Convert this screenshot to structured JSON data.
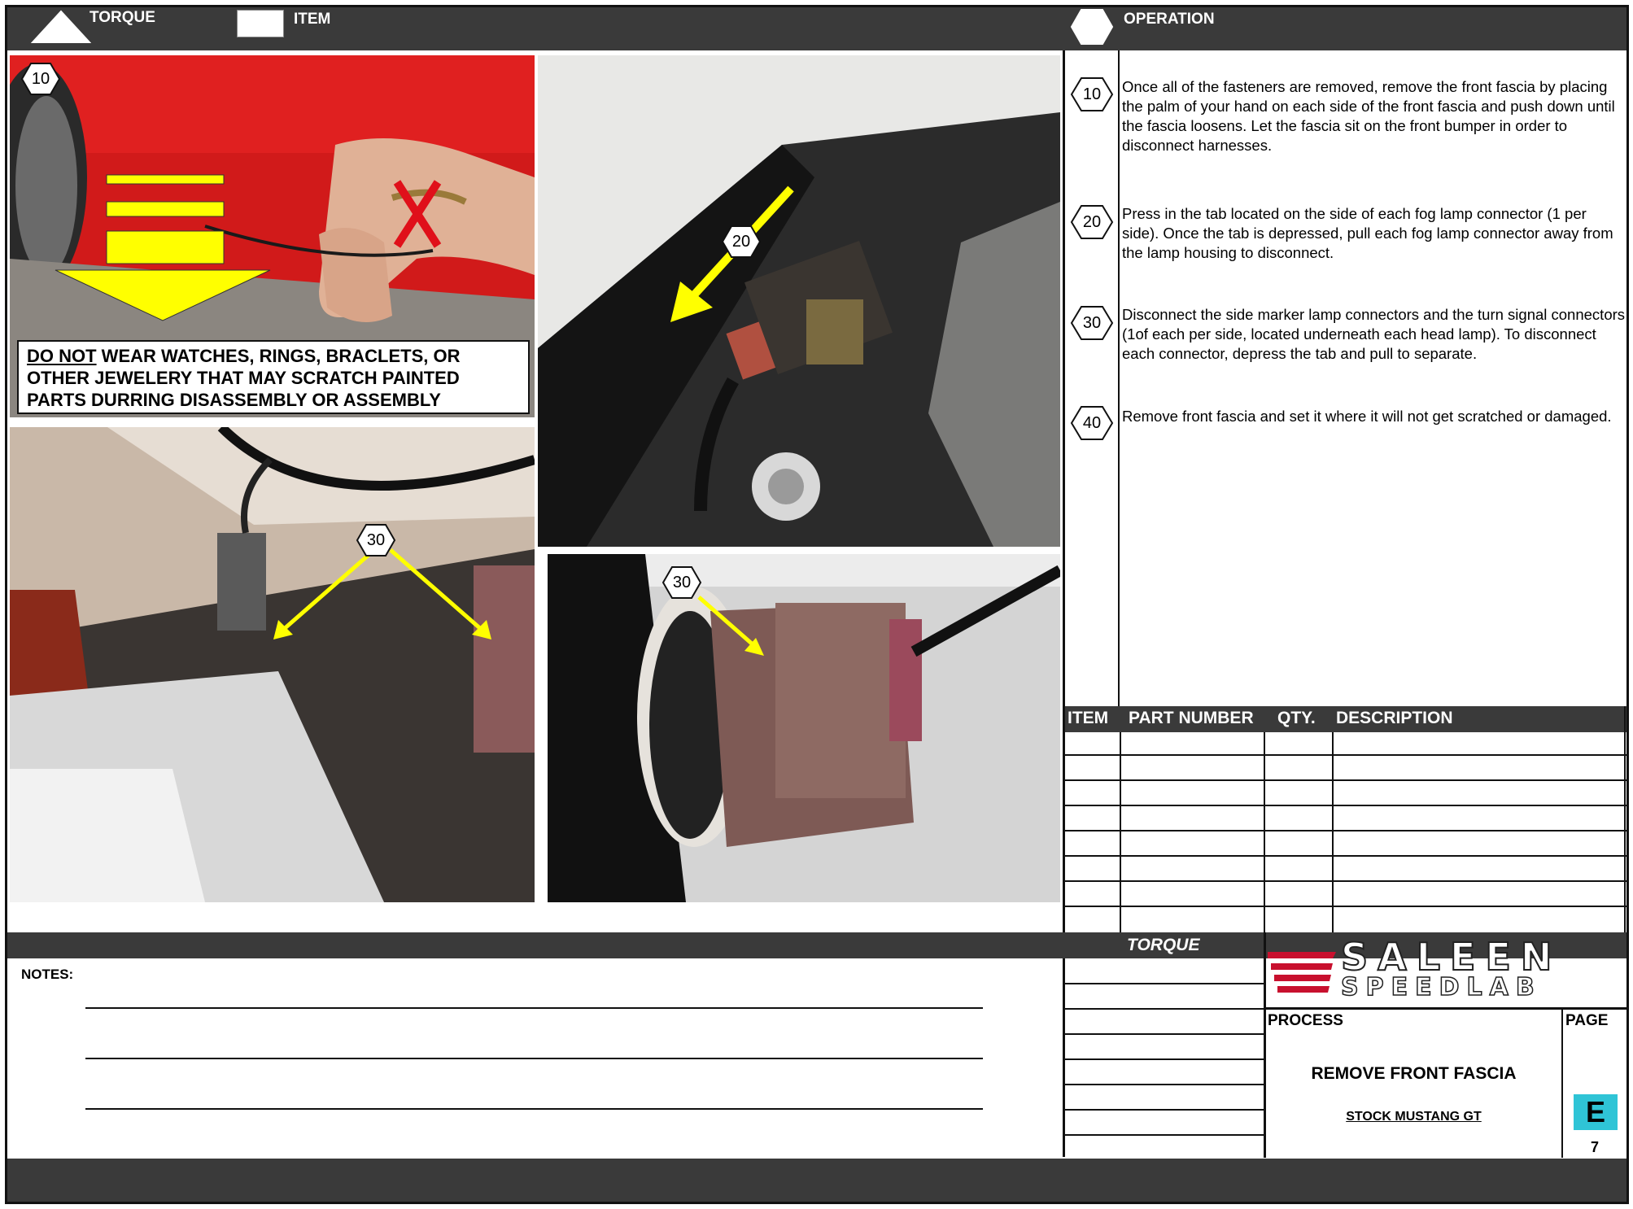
{
  "header": {
    "torque_label": "TORQUE",
    "item_label": "ITEM",
    "operation_label": "OPERATION"
  },
  "warning": {
    "emphasis": "DO NOT",
    "text": " WEAR WATCHES, RINGS, BRACLETS, OR OTHER JEWELERY THAT MAY SCRATCH PAINTED PARTS DURRING DISASSEMBLY OR ASSEMBLY"
  },
  "photo_callouts": {
    "photo1": "10",
    "photo2": "20",
    "photo3": "30",
    "photo4": "30"
  },
  "operations": [
    {
      "number": "10",
      "text": "Once all of the fasteners are removed, remove the front fascia by placing the palm of your hand on each side of the front fascia and push down until the fascia loosens.  Let the fascia sit on the front bumper in order to disconnect harnesses."
    },
    {
      "number": "20",
      "text": "Press in the tab located on the side of each fog lamp connector (1 per side).  Once the tab is depressed, pull each fog lamp connector away from the lamp housing to disconnect."
    },
    {
      "number": "30",
      "text": "Disconnect the side marker lamp connectors and the turn signal connectors (1of each per side, located underneath each head lamp).  To disconnect each connector, depress the tab and pull to separate."
    },
    {
      "number": "40",
      "text": "Remove front fascia and set it where it will not get scratched or damaged."
    }
  ],
  "parts_table": {
    "columns": [
      "ITEM",
      "PART NUMBER",
      "QTY.",
      "DESCRIPTION"
    ],
    "rows": []
  },
  "footer": {
    "torque_label": "TORQUE",
    "notes_label": "NOTES:",
    "brand_line1": "SALEEN",
    "brand_line2": "SPEEDLAB",
    "process_label": "PROCESS",
    "page_label": "PAGE",
    "process_title": "REMOVE FRONT FASCIA",
    "process_subtitle": "STOCK MUSTANG GT",
    "page_letter": "E",
    "page_number": "7"
  },
  "colors": {
    "header_bar": "#3a3a3a",
    "arrow_yellow": "#ffff00",
    "cross_red": "#e0101a",
    "page_letter_bg": "#2fc4d6",
    "brand_red": "#c8102e"
  }
}
